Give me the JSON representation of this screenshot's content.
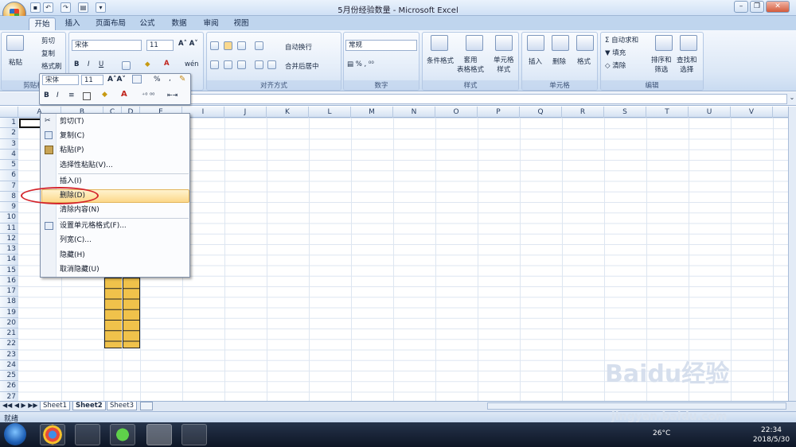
{
  "window": {
    "title": "5月份经验数量 - Microsoft Excel"
  },
  "tabs": [
    "开始",
    "插入",
    "页面布局",
    "公式",
    "数据",
    "审阅",
    "视图"
  ],
  "ribbon": {
    "clipboard": {
      "paste": "粘贴",
      "cut": "剪切",
      "copy": "复制",
      "format_painter": "格式刷",
      "label": "剪贴板"
    },
    "font": {
      "name": "宋体",
      "size": "11"
    },
    "alignment": {
      "wrap": "自动换行",
      "merge": "合并后居中",
      "label": "对齐方式"
    },
    "number": {
      "format": "常规",
      "label": "数字"
    },
    "styles": {
      "conditional": "条件格式",
      "table": "套用\n表格格式",
      "cell": "单元格\n样式",
      "label": "样式"
    },
    "cells": {
      "insert": "插入",
      "delete": "删除",
      "format": "格式",
      "label": "单元格"
    },
    "editing": {
      "autosum": "自动求和",
      "fill": "填充",
      "clear": "清除",
      "sort": "排序和\n筛选",
      "find": "查找和\n选择",
      "label": "编辑"
    }
  },
  "minitoolbar": {
    "font": "宋体",
    "size": "11",
    "percent": "%",
    "comma": ","
  },
  "columns": [
    "A",
    "B",
    "C",
    "D",
    "E",
    "I",
    "J",
    "K",
    "L",
    "M",
    "N",
    "O",
    "P",
    "Q",
    "R",
    "S",
    "T",
    "U",
    "V"
  ],
  "rows": [
    "1",
    "2",
    "3",
    "4",
    "5",
    "6",
    "7",
    "8",
    "9",
    "10",
    "11",
    "12",
    "13",
    "14",
    "15",
    "16",
    "17",
    "18",
    "19",
    "20",
    "21",
    "22",
    "23",
    "24",
    "25",
    "26",
    "27"
  ],
  "context_menu": [
    "剪切(T)",
    "复制(C)",
    "粘贴(P)",
    "选择性粘贴(V)...",
    "插入(I)",
    "删除(D)",
    "清除内容(N)",
    "设置单元格格式(F)...",
    "列宽(C)...",
    "隐藏(H)",
    "取消隐藏(U)"
  ],
  "sheets": [
    "Sheet1",
    "Sheet2",
    "Sheet3"
  ],
  "status": "就绪",
  "tray": {
    "temp": "26°C",
    "time": "22:34",
    "date": "2018/5/30"
  },
  "watermark": {
    "brand": "Baidu经验",
    "url": "jingyan.baidu.com"
  }
}
